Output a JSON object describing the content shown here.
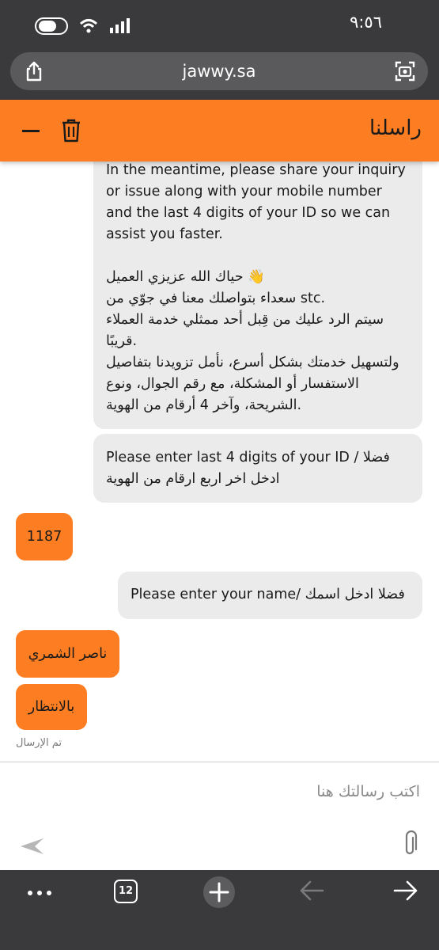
{
  "status_bar": {
    "time": "٩:٥٦"
  },
  "browser": {
    "url": "jawwy.sa",
    "tab_count": "12"
  },
  "chat_header": {
    "title": "راسلنا"
  },
  "messages": {
    "bot_intro": {
      "lines": [
        "In the meantime, please share your inquiry",
        "or issue along with your mobile number",
        "and the last 4 digits of your ID so we can",
        "assist you faster.",
        "",
        "حياك الله عزيزي العميل 👋",
        "سعداء بتواصلك معنا في جوّي من stc.",
        "سيتم الرد عليك من قِبل أحد ممثلي خدمة العملاء",
        "قريبًا.",
        "ولتسهيل خدمتك بشكل أسرع، نأمل تزويدنا بتفاصيل",
        "الاستفسار أو المشكلة، مع رقم الجوال، ونوع",
        "الشريحة، وآخر 4 أرقام من الهوية."
      ]
    },
    "bot_id_request": {
      "lines": [
        "Please enter last 4 digits of your ID / فضلا",
        "ادخل اخر اربع ارقام من الهوية"
      ]
    },
    "user_id": "1187",
    "bot_name_request": "Please enter your name/ فضلا ادخل اسمك",
    "user_name": "ناصر الشمري",
    "user_waiting": "بالانتظار",
    "sent_status": "تم الإرسال"
  },
  "composer": {
    "placeholder": "اكتب رسالتك هنا"
  },
  "colors": {
    "accent": "#fd7e22",
    "bubble_in": "#ebebeb",
    "chrome": "#3a3a3c"
  }
}
